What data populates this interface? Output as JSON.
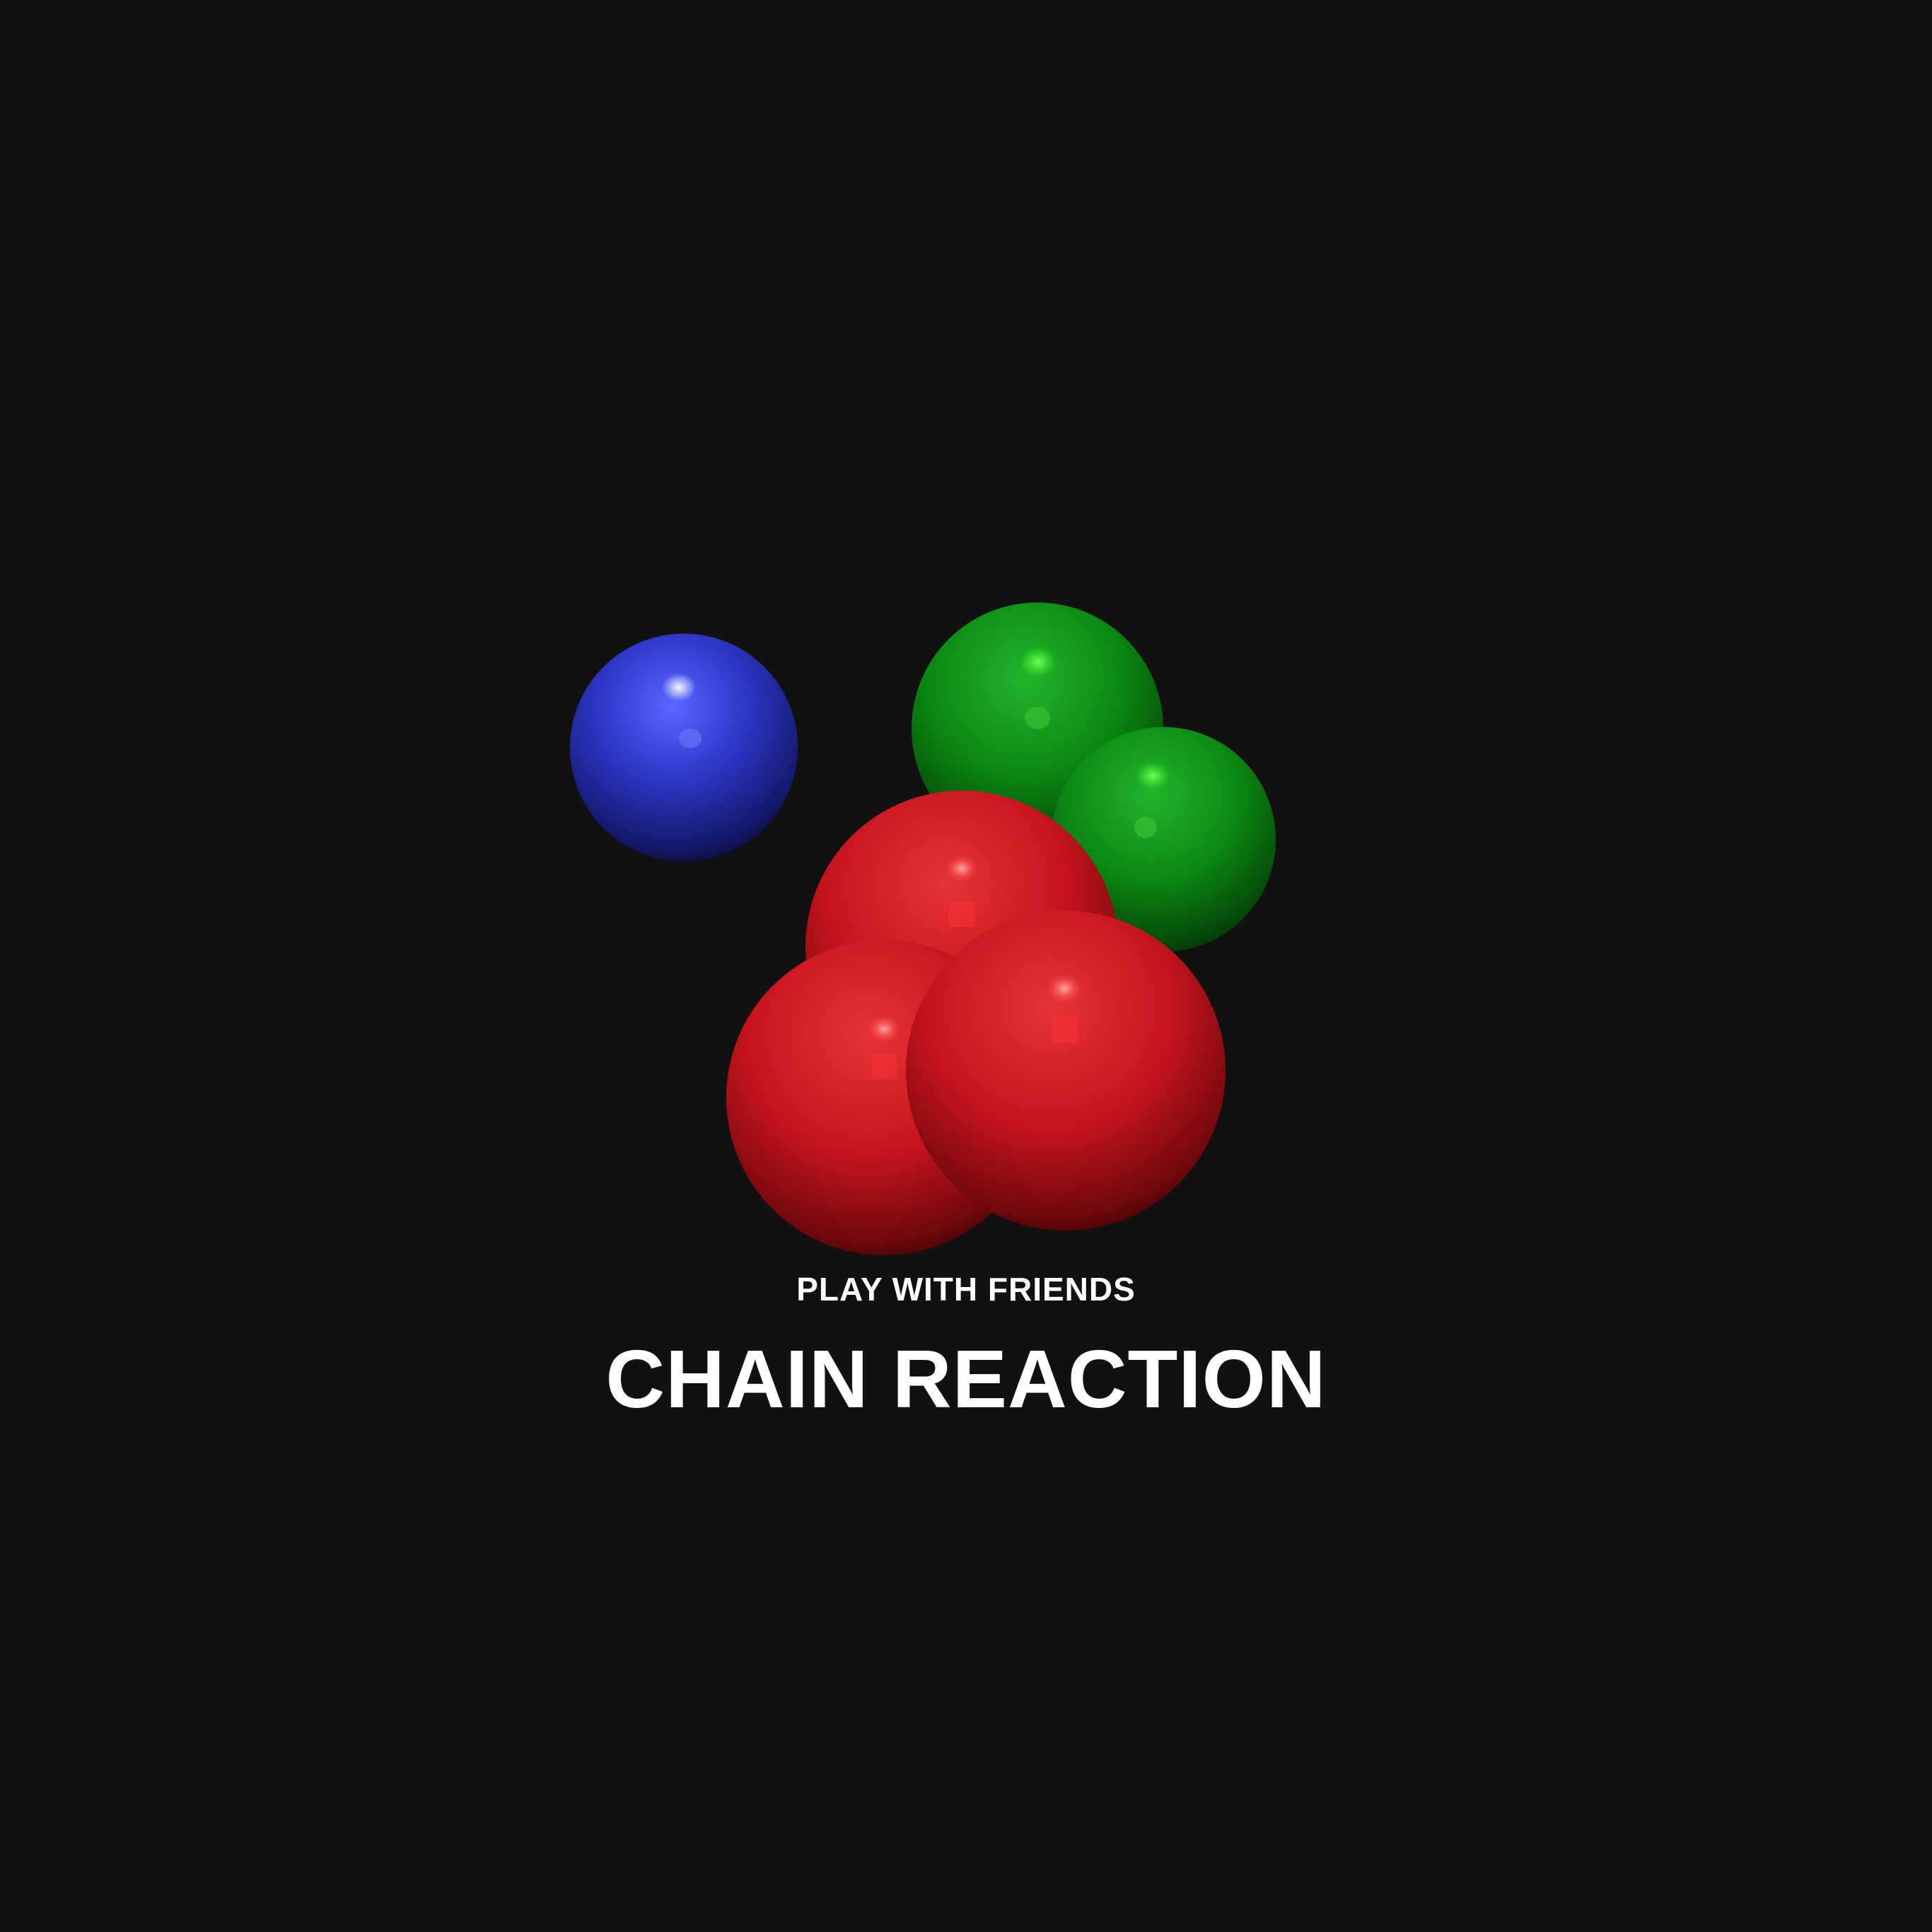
{
  "screen": {
    "tagline": "PLAY WITH FRIENDS",
    "title": "CHAIN REACTION",
    "background_color": "#111111"
  },
  "orbs": [
    {
      "player": "blue",
      "color": "#2e36c8",
      "count": 1
    },
    {
      "player": "green",
      "color": "#0b8a12",
      "count": 2
    },
    {
      "player": "red",
      "color": "#c8141c",
      "count": 3
    }
  ]
}
